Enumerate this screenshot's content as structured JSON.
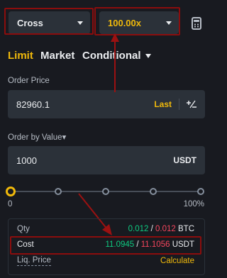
{
  "margin_mode": {
    "label": "Cross"
  },
  "leverage": {
    "label": "100.00x"
  },
  "tabs": [
    {
      "label": "Limit"
    },
    {
      "label": "Market"
    },
    {
      "label": "Conditional"
    }
  ],
  "order_price": {
    "label": "Order Price",
    "value": "82960.1",
    "price_type": "Last"
  },
  "order_value": {
    "label": "Order by Value▾",
    "value": "1000",
    "unit": "USDT"
  },
  "slider": {
    "min_label": "0",
    "max_label": "100%",
    "position_fraction": 0.0
  },
  "info": {
    "qty": {
      "label": "Qty",
      "buy": "0.012",
      "sep": "/",
      "sell": "0.012",
      "unit": "BTC"
    },
    "cost": {
      "label": "Cost",
      "buy": "11.0945",
      "sep": "/",
      "sell": "11.1056",
      "unit": "USDT"
    },
    "liq": {
      "label": "Liq. Price",
      "action": "Calculate"
    }
  },
  "colors": {
    "accent": "#f0b90b",
    "buy": "#0ecb81",
    "sell": "#f6465d",
    "highlight_box": "#8b0d0d"
  }
}
